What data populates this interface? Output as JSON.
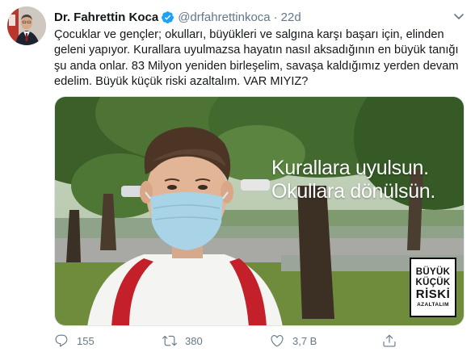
{
  "author": {
    "display_name": "Dr. Fahrettin Koca",
    "handle": "@drfahrettinkoca",
    "separator": "·",
    "time": "22d",
    "verified": true,
    "avatar_icon": "profile-photo",
    "verified_icon": "verified-badge-icon"
  },
  "tweet": {
    "lines": [
      "Çocuklar ve gençler; okulları, büyükleri ve salgına karşı başarı için, elinden",
      "geleni yapıyor. Kurallara uyulmazsa hayatın nasıl aksadığının en büyük tanığı",
      "şu anda onlar. 83 Milyon yeniden birleşelim, savaşa kaldığımız yerden devam",
      "edelim. Büyük küçük riski azaltalım. VAR MIYIZ?"
    ]
  },
  "media": {
    "overlay_line1": "Kurallara uyulsun.",
    "overlay_line2": "Okullara dönülsün.",
    "logo": {
      "line1": "BÜYÜK",
      "line2": "KÜÇÜK",
      "line3": "RİSKİ",
      "line4": "AZALTALIM"
    }
  },
  "actions": {
    "reply_count": "155",
    "retweet_count": "380",
    "like_count": "3,7 B",
    "reply_icon": "reply-icon",
    "retweet_icon": "retweet-icon",
    "like_icon": "heart-icon",
    "share_icon": "share-icon"
  },
  "colors": {
    "text": "#14171a",
    "secondary": "#657786",
    "verified": "#1da1f2"
  }
}
